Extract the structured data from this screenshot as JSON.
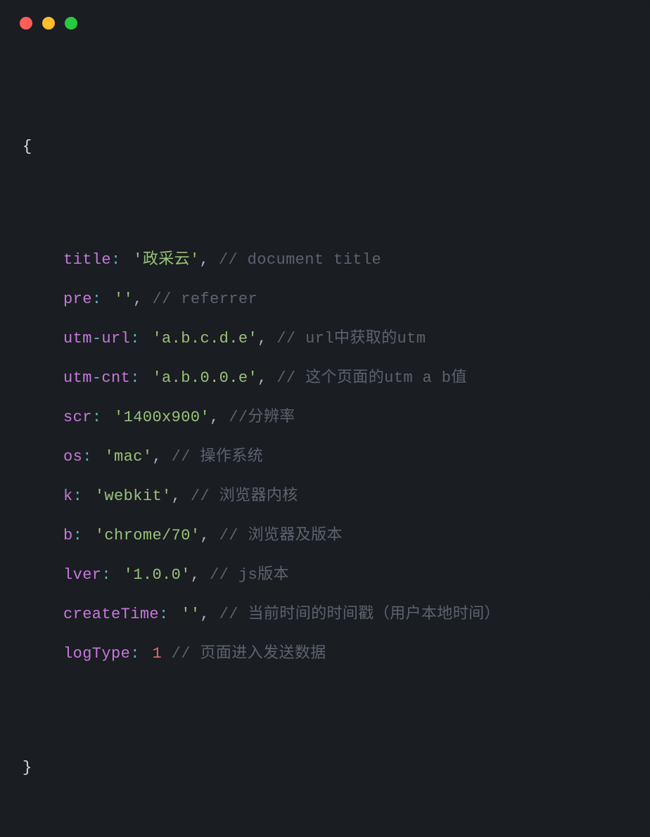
{
  "traffic": {
    "red": "#ff5f56",
    "yellow": "#ffbd2e",
    "green": "#27c93f"
  },
  "braces": {
    "open": "{",
    "close": "}"
  },
  "lines": [
    {
      "key": "title",
      "key2": null,
      "value": "'政采云'",
      "valueType": "str",
      "comma": ",",
      "commentPrefix": " // ",
      "comment": "document title"
    },
    {
      "key": "pre",
      "key2": null,
      "value": "''",
      "valueType": "str",
      "comma": ",",
      "commentPrefix": " // ",
      "comment": "referrer"
    },
    {
      "key": "utm",
      "key2": "url",
      "value": "'a.b.c.d.e'",
      "valueType": "str",
      "comma": ",",
      "commentPrefix": " // ",
      "comment": "url中获取的utm"
    },
    {
      "key": "utm",
      "key2": "cnt",
      "value": "'a.b.0.0.e'",
      "valueType": "str",
      "comma": ",",
      "commentPrefix": " // ",
      "comment": "这个页面的utm a b值"
    },
    {
      "key": "scr",
      "key2": null,
      "value": "'1400x900'",
      "valueType": "str",
      "comma": ",",
      "commentPrefix": " //",
      "comment": "分辨率"
    },
    {
      "key": "os",
      "key2": null,
      "value": "'mac'",
      "valueType": "str",
      "comma": ",",
      "commentPrefix": " // ",
      "comment": "操作系统"
    },
    {
      "key": "k",
      "key2": null,
      "value": "'webkit'",
      "valueType": "str",
      "comma": ",",
      "commentPrefix": " // ",
      "comment": "浏览器内核"
    },
    {
      "key": "b",
      "key2": null,
      "value": "'chrome/70'",
      "valueType": "str",
      "comma": ",",
      "commentPrefix": " // ",
      "comment": "浏览器及版本"
    },
    {
      "key": "lver",
      "key2": null,
      "value": "'1.0.0'",
      "valueType": "str",
      "comma": ",",
      "commentPrefix": " // ",
      "comment": "js版本"
    },
    {
      "key": "createTime",
      "key2": null,
      "value": "''",
      "valueType": "str",
      "comma": ",",
      "commentPrefix": " // ",
      "comment": "当前时间的时间戳（用户本地时间）"
    },
    {
      "key": "logType",
      "key2": null,
      "value": "1",
      "valueType": "num",
      "comma": "",
      "commentPrefix": " // ",
      "comment": "页面进入发送数据"
    }
  ]
}
